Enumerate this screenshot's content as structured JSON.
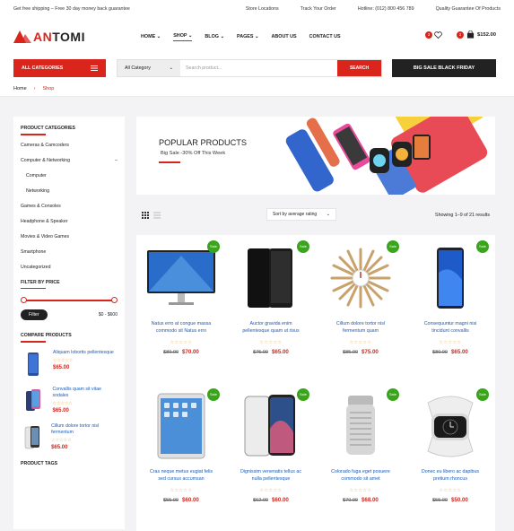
{
  "topbar": {
    "left": "Get free shipping – Free 30 day money back guarantee",
    "links": [
      "Store Locations",
      "Track Your Order",
      "Hotline: (012) 800 456 789",
      "Quality Guarantee Of Products"
    ]
  },
  "logo": {
    "part1": "AN",
    "part2": "TOMI"
  },
  "nav": [
    "HOME",
    "SHOP",
    "BLOG",
    "PAGES",
    "ABOUT US",
    "CONTACT US"
  ],
  "header": {
    "wishlist_count": "3",
    "cart_count": "2",
    "cart_total": "$152.00"
  },
  "search": {
    "all_categories": "ALL CATEGORIES",
    "select_value": "All Category",
    "placeholder": "Search product...",
    "button": "SEARCH",
    "big_sale": "BIG SALE BLACK FRIDAY"
  },
  "breadcrumb": {
    "home": "Home",
    "current": "Shop"
  },
  "sidebar": {
    "categories_title": "PRODUCT CATEGORIES",
    "categories": [
      "Cameras & Camcoders",
      "Computer & Networking",
      "Computer",
      "Networking",
      "Games & Consoles",
      "Headphone & Speaker",
      "Movies & Video Games",
      "Smartphone",
      "Uncategorized"
    ],
    "filter_title": "FILTER BY PRICE",
    "filter_button": "Filter",
    "price_range": "$0 - $600",
    "compare_title": "COMPARE PRODUCTS",
    "compare": [
      {
        "name": "Aliquam lobortis pellentesque",
        "price": "$65.00"
      },
      {
        "name": "Convallis quam sit vitae sodales",
        "price": "$65.00"
      },
      {
        "name": "Cillum dolore tortor nisl fermentum",
        "price": "$65.00"
      }
    ],
    "tags_title": "PRODUCT TAGS"
  },
  "banner": {
    "title": "POPULAR PRODUCTS",
    "subtitle": "Big Sale -30% Off This Week"
  },
  "toolbar": {
    "sort": "Sort by average rating",
    "showing": "Showing 1–9 of 21 results"
  },
  "sale_label": "Sale",
  "products": [
    {
      "name": "Natus erro at congue massa commodo sit Natus erro",
      "old": "$80.00",
      "new": "$70.00",
      "icon": "monitor"
    },
    {
      "name": "Auctor gravida enim pellentesque quam ut risus",
      "old": "$75.00",
      "new": "$65.00",
      "icon": "phone-black"
    },
    {
      "name": "Cillum dolore tortor nisl fermentum quam",
      "old": "$85.00",
      "new": "$75.00",
      "icon": "sunburst-clock"
    },
    {
      "name": "Consequuntur magni nisi tincidunt convallis",
      "old": "$80.00",
      "new": "$65.00",
      "icon": "phone-blue"
    },
    {
      "name": "Cras neque metus eugiat felis sed cursus accumsan",
      "old": "$55.00",
      "new": "$60.00",
      "icon": "tablet"
    },
    {
      "name": "Dignissim venenatis tellus ac nulla pellentesque",
      "old": "$62.00",
      "new": "$60.00",
      "icon": "phone-x"
    },
    {
      "name": "Colorado fuga eget posuere commodo sit amet",
      "old": "$70.00",
      "new": "$68.00",
      "icon": "speaker"
    },
    {
      "name": "Donec eu libero ac dapibus pretium rhoncus",
      "old": "$55.00",
      "new": "$50.00",
      "icon": "smartwatch"
    }
  ],
  "colors": {
    "accent": "#d9251c",
    "sale": "#3aa51c",
    "link": "#1a5bb5"
  }
}
